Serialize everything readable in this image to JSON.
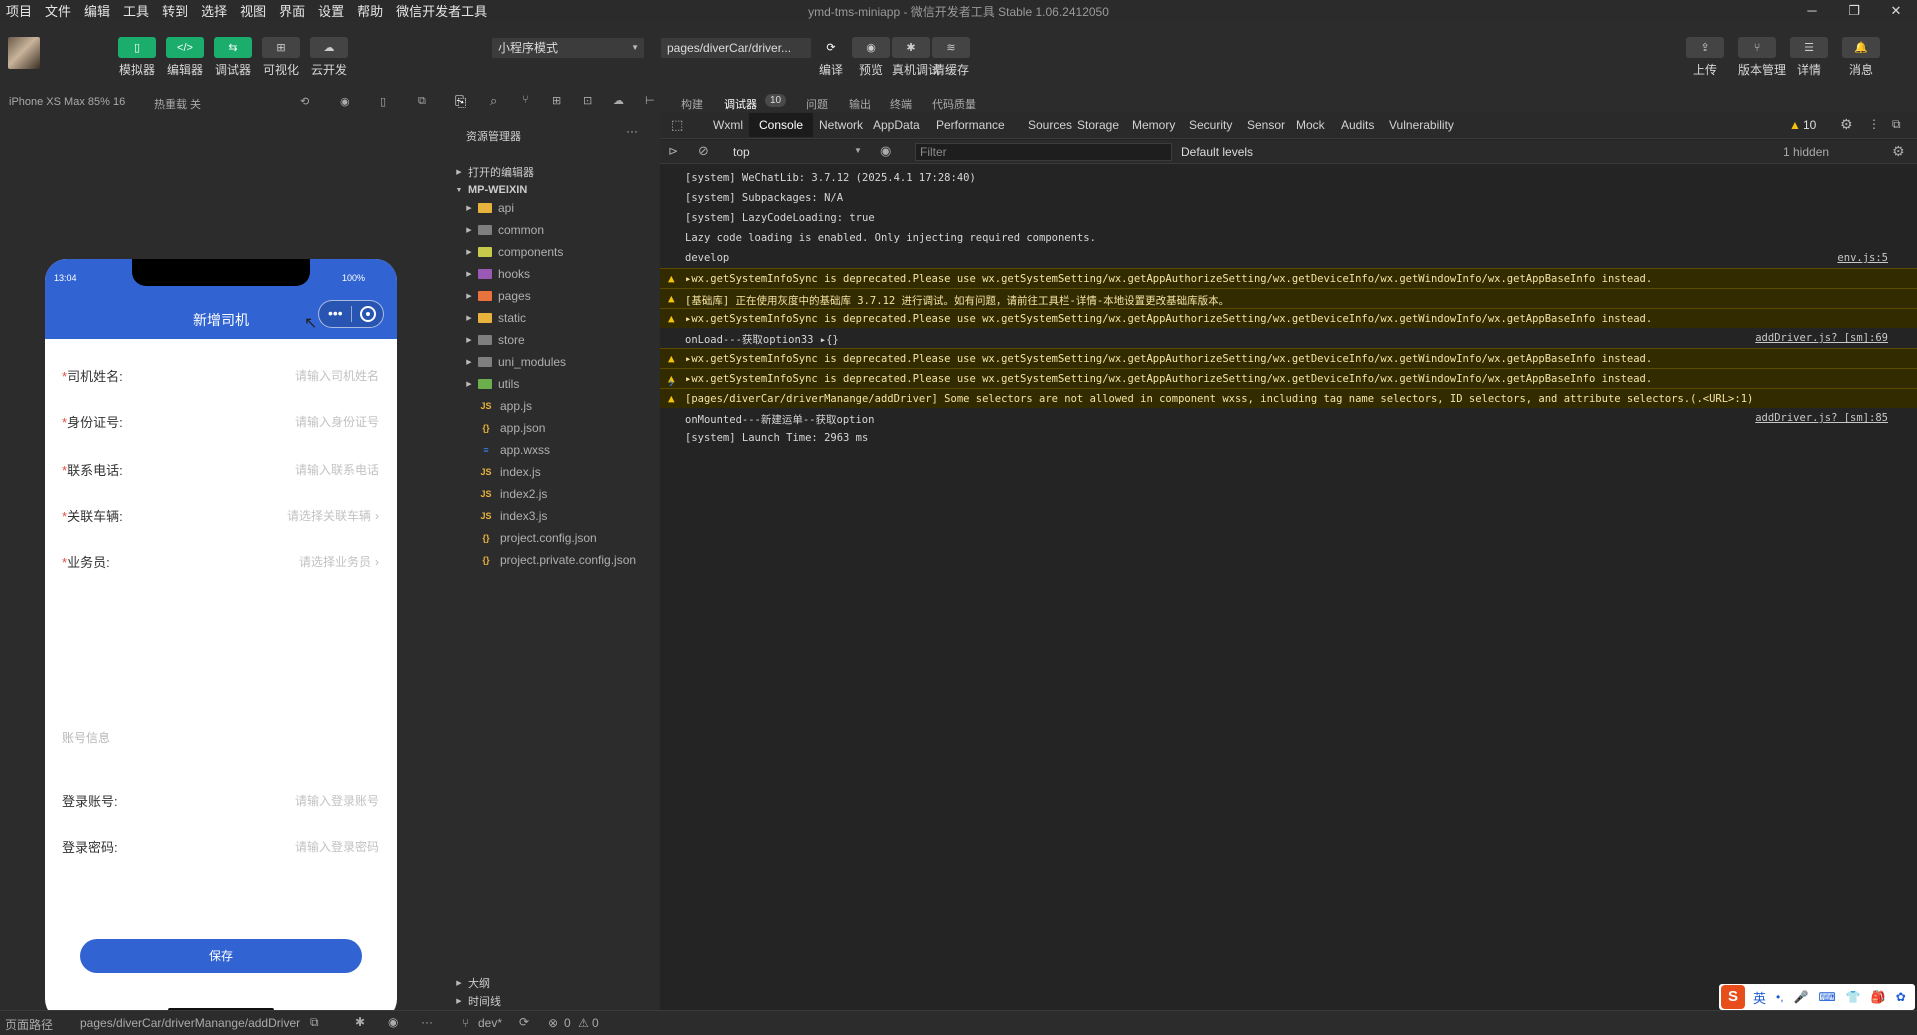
{
  "menu": [
    "项目",
    "文件",
    "编辑",
    "工具",
    "转到",
    "选择",
    "视图",
    "界面",
    "设置",
    "帮助",
    "微信开发者工具"
  ],
  "window_title": "ymd-tms-miniapp - 微信开发者工具 Stable 1.06.2412050",
  "window_controls": [
    "─",
    "❐",
    "✕"
  ],
  "toolbar": {
    "left_buttons": [
      {
        "label": "模拟器",
        "icon": "phone-icon",
        "glyph": "▯"
      },
      {
        "label": "编辑器",
        "icon": "code-icon",
        "glyph": "</>"
      },
      {
        "label": "调试器",
        "icon": "debug-icon",
        "glyph": "⇆"
      },
      {
        "label": "可视化",
        "icon": "layout-icon",
        "glyph": "⊞"
      },
      {
        "label": "云开发",
        "icon": "cloud-icon",
        "glyph": "☁"
      }
    ],
    "mode": "小程序模式",
    "page": "pages/diverCar/driver...",
    "mid_buttons": [
      {
        "label": "编译",
        "icon": "refresh-icon",
        "glyph": "⟳"
      },
      {
        "label": "预览",
        "icon": "eye-icon",
        "glyph": "◉"
      },
      {
        "label": "真机调试",
        "icon": "bug-icon",
        "glyph": "✱"
      },
      {
        "label": "清缓存",
        "icon": "layers-icon",
        "glyph": "≋"
      }
    ],
    "right_buttons": [
      {
        "label": "上传",
        "icon": "upload-icon",
        "glyph": "⇪"
      },
      {
        "label": "版本管理",
        "icon": "branch-icon",
        "glyph": "⑂"
      },
      {
        "label": "详情",
        "icon": "menu-icon",
        "glyph": "☰"
      },
      {
        "label": "消息",
        "icon": "bell-icon",
        "glyph": "🔔"
      }
    ]
  },
  "subbar": {
    "device": "iPhone XS Max 85% 16",
    "hot_reload": "热重载 关",
    "panel_tabs": [
      "构建",
      "调试器",
      "问题",
      "输出",
      "终端",
      "代码质量"
    ],
    "debugger_badge": "10"
  },
  "simulator": {
    "time": "13:04",
    "battery": "100%",
    "title": "新增司机",
    "fields": [
      {
        "label": "司机姓名:",
        "placeholder": "请输入司机姓名",
        "required": true,
        "arrow": false
      },
      {
        "label": "身份证号:",
        "placeholder": "请输入身份证号",
        "required": true,
        "arrow": false
      },
      {
        "label": "联系电话:",
        "placeholder": "请输入联系电话",
        "required": true,
        "arrow": false
      },
      {
        "label": "关联车辆:",
        "placeholder": "请选择关联车辆",
        "required": true,
        "arrow": true
      },
      {
        "label": "业务员:",
        "placeholder": "请选择业务员",
        "required": true,
        "arrow": true
      }
    ],
    "section_title": "账号信息",
    "account_fields": [
      {
        "label": "登录账号:",
        "placeholder": "请输入登录账号"
      },
      {
        "label": "登录密码:",
        "placeholder": "请输入登录密码"
      }
    ],
    "save_label": "保存",
    "required_mark": "*"
  },
  "explorer": {
    "title": "资源管理器",
    "open_editors": "打开的编辑器",
    "root": "MP-WEIXIN",
    "folders": [
      {
        "name": "api",
        "color": "#e8b33c"
      },
      {
        "name": "common",
        "color": "#7f7f7f"
      },
      {
        "name": "components",
        "color": "#c6c94a"
      },
      {
        "name": "hooks",
        "color": "#9b59b6"
      },
      {
        "name": "pages",
        "color": "#e8733c"
      },
      {
        "name": "static",
        "color": "#e8b33c"
      },
      {
        "name": "store",
        "color": "#7f7f7f"
      },
      {
        "name": "uni_modules",
        "color": "#7f7f7f"
      },
      {
        "name": "utils",
        "color": "#6ab04c"
      }
    ],
    "files": [
      {
        "name": "app.js",
        "type": "js"
      },
      {
        "name": "app.json",
        "type": "json"
      },
      {
        "name": "app.wxss",
        "type": "css"
      },
      {
        "name": "index.js",
        "type": "js"
      },
      {
        "name": "index2.js",
        "type": "js"
      },
      {
        "name": "index3.js",
        "type": "js"
      },
      {
        "name": "project.config.json",
        "type": "json"
      },
      {
        "name": "project.private.config.json",
        "type": "json"
      }
    ],
    "outline": "大纲",
    "timeline": "时间线"
  },
  "debugger": {
    "tabs": [
      "Wxml",
      "Console",
      "Network",
      "AppData",
      "Performance",
      "Sources",
      "Storage",
      "Memory",
      "Security",
      "Sensor",
      "Mock",
      "Audits",
      "Vulnerability"
    ],
    "active_tab": "Console",
    "warn_count": "10",
    "context": "top",
    "filter_placeholder": "Filter",
    "levels": "Default levels",
    "hidden": "1 hidden",
    "console": [
      {
        "type": "log",
        "text": "[system] WeChatLib: 3.7.12 (2025.4.1 17:28:40)",
        "src": ""
      },
      {
        "type": "log",
        "text": "[system] Subpackages: N/A",
        "src": ""
      },
      {
        "type": "log",
        "text": "[system] LazyCodeLoading: true",
        "src": ""
      },
      {
        "type": "log",
        "text": "Lazy code loading is enabled. Only injecting required components.",
        "src": ""
      },
      {
        "type": "log",
        "text": "develop",
        "src": "env.js:5"
      },
      {
        "type": "warn",
        "text": "▸wx.getSystemInfoSync is deprecated.Please use wx.getSystemSetting/wx.getAppAuthorizeSetting/wx.getDeviceInfo/wx.getWindowInfo/wx.getAppBaseInfo instead.",
        "src": ""
      },
      {
        "type": "warn",
        "text": "[基础库] 正在使用灰度中的基础库 3.7.12 进行调试。如有问题，请前往工具栏-详情-本地设置更改基础库版本。",
        "src": ""
      },
      {
        "type": "warn",
        "text": "▸wx.getSystemInfoSync is deprecated.Please use wx.getSystemSetting/wx.getAppAuthorizeSetting/wx.getDeviceInfo/wx.getWindowInfo/wx.getAppBaseInfo instead.",
        "src": ""
      },
      {
        "type": "log",
        "text": "onLoad---获取option33 ▸{}",
        "src": "addDriver.js? [sm]:69"
      },
      {
        "type": "warn",
        "text": "▸wx.getSystemInfoSync is deprecated.Please use wx.getSystemSetting/wx.getAppAuthorizeSetting/wx.getDeviceInfo/wx.getWindowInfo/wx.getAppBaseInfo instead.",
        "src": ""
      },
      {
        "type": "warn",
        "text": "▸wx.getSystemInfoSync is deprecated.Please use wx.getSystemSetting/wx.getAppAuthorizeSetting/wx.getDeviceInfo/wx.getWindowInfo/wx.getAppBaseInfo instead.",
        "src": ""
      },
      {
        "type": "warn",
        "text": "[pages/diverCar/driverManange/addDriver] Some selectors are not allowed in component wxss, including tag name selectors, ID selectors, and attribute selectors.(.<URL>:1)",
        "src": ""
      },
      {
        "type": "log",
        "text": "onMounted---新建运单--获取option",
        "src": "addDriver.js? [sm]:85"
      },
      {
        "type": "log",
        "text": "[system] Launch Time: 2963 ms",
        "src": ""
      }
    ],
    "prompt": "›"
  },
  "statusbar": {
    "page_path_label": "页面路径",
    "page_path": "pages/diverCar/driverManange/addDriver",
    "branch": "dev*",
    "errors": "0",
    "warnings": "0"
  },
  "ime": {
    "lang": "英",
    "items": [
      "•,",
      "🎤",
      "⌨",
      "👕",
      "🎒",
      "✿"
    ]
  }
}
